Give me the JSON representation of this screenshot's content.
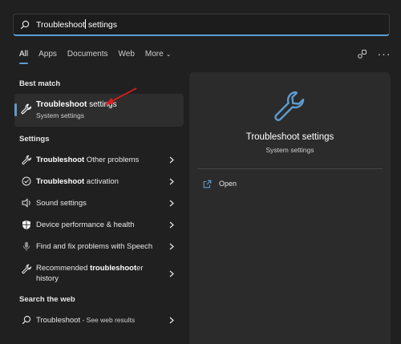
{
  "search": {
    "query_bold": "Troubleshoot",
    "query_rest": " settings"
  },
  "tabs": [
    {
      "label": "All"
    },
    {
      "label": "Apps"
    },
    {
      "label": "Documents"
    },
    {
      "label": "Web"
    },
    {
      "label": "More"
    }
  ],
  "sections": {
    "best_match": "Best match",
    "settings": "Settings",
    "search_web": "Search the web"
  },
  "best_match": {
    "title_bold": "Troubleshoot",
    "title_rest": " settings",
    "subtitle": "System settings"
  },
  "settings_items": [
    {
      "bold": "Troubleshoot",
      "rest": " Other problems",
      "icon": "wrench-icon"
    },
    {
      "bold": "Troubleshoot",
      "rest": " activation",
      "icon": "check-circle-icon"
    },
    {
      "bold": "",
      "rest": "Sound settings",
      "icon": "speaker-icon"
    },
    {
      "bold": "",
      "rest": "Device performance & health",
      "icon": "shield-icon"
    },
    {
      "bold": "",
      "rest": "Find and fix problems with Speech",
      "icon": "microphone-icon"
    },
    {
      "line1_pre": "Recommended ",
      "line1_bold": "troubleshoot",
      "line1_post": "er",
      "line2": "history",
      "icon": "wrench-icon"
    }
  ],
  "web_item": {
    "text": "Troubleshoot",
    "suffix": " - See web results",
    "icon": "search-icon"
  },
  "detail": {
    "title": "Troubleshoot settings",
    "subtitle": "System settings",
    "open_label": "Open"
  },
  "colors": {
    "accent": "#5d9ccf",
    "arrow": "#e01b1b"
  }
}
